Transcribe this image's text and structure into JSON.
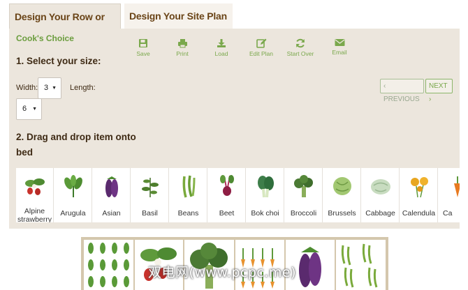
{
  "tabs": [
    {
      "label": "Design Your Row or Bed",
      "active": true
    },
    {
      "label": "Design Your Site Plan",
      "active": false
    }
  ],
  "cooks_choice": "Cook's Choice",
  "toolbar": [
    {
      "label": "Save",
      "icon": "save-icon"
    },
    {
      "label": "Print",
      "icon": "print-icon"
    },
    {
      "label": "Load",
      "icon": "download-icon"
    },
    {
      "label": "Edit Plan",
      "icon": "edit-icon"
    },
    {
      "label": "Start Over",
      "icon": "refresh-icon"
    },
    {
      "label": "Email",
      "icon": "envelope-icon"
    }
  ],
  "step1": {
    "heading": "1. Select your size:",
    "width_label": "Width:",
    "width_value": "3",
    "length_label": "Length:",
    "length_value": "6"
  },
  "pager": {
    "prev": "‹ PREVIOUS",
    "next": "NEXT ›"
  },
  "step2": {
    "heading_line1": "2. Drag and drop item onto",
    "heading_line2": "bed"
  },
  "plants": [
    "Alpine strawberry",
    "Arugula",
    "Asian",
    "Basil",
    "Beans",
    "Beet",
    "Bok choi",
    "Broccoli",
    "Brussels",
    "Cabbage",
    "Calendula",
    "Ca"
  ],
  "watermark": "双电网(www.pcpc.me)",
  "colors": {
    "accent_green": "#7aa84c",
    "tab_text": "#6a4417",
    "panel_bg": "#ece6dd"
  }
}
